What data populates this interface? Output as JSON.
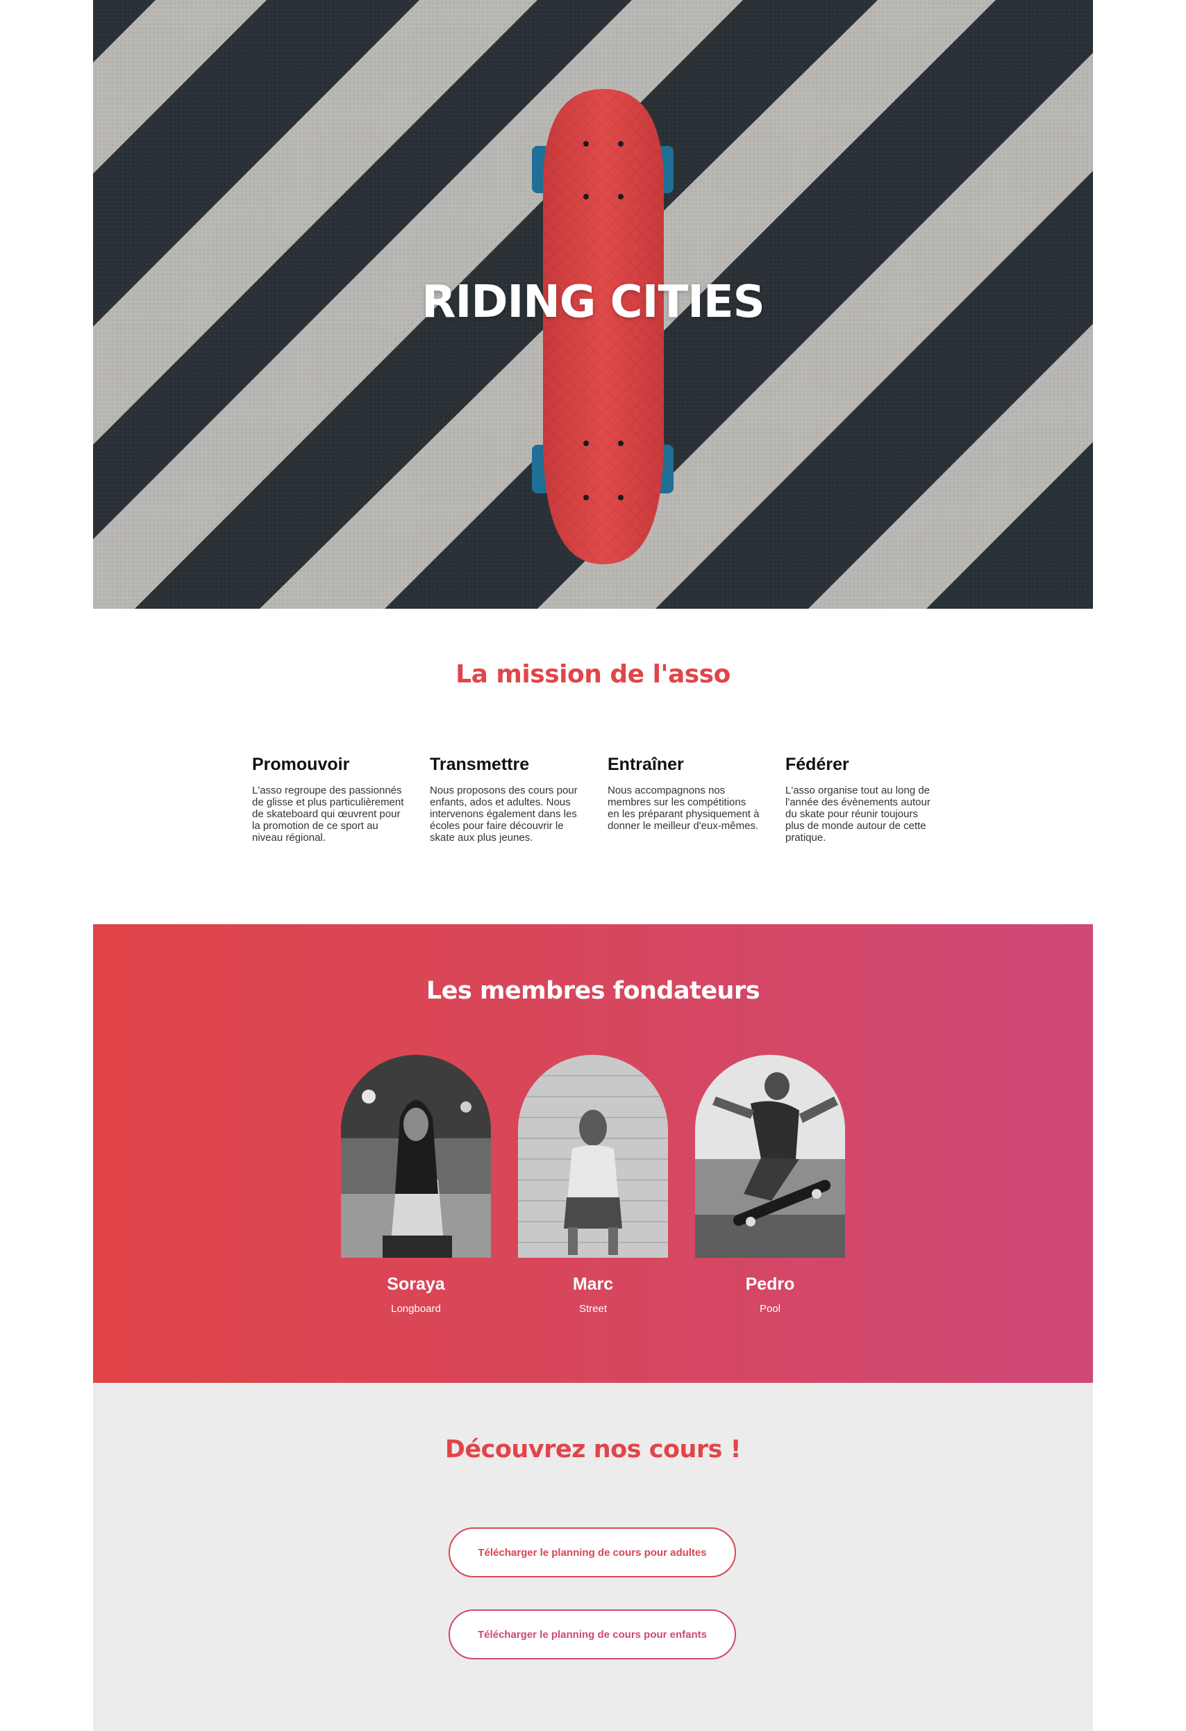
{
  "hero": {
    "title": "RIDING CITIES"
  },
  "mission": {
    "title": "La mission de l'asso",
    "pillars": [
      {
        "title": "Promouvoir",
        "text": "L'asso regroupe des passionnés de glisse et plus particulièrement de skateboard qui œuvrent pour la promotion de ce sport au niveau régional."
      },
      {
        "title": "Transmettre",
        "text": "Nous proposons des cours pour enfants, ados et adultes. Nous intervenons également dans les écoles pour faire découvrir le skate aux plus jeunes."
      },
      {
        "title": "Entraîner",
        "text": "Nous accompagnons nos membres sur les compétitions en les préparant physiquement à donner le meilleur d'eux-mêmes."
      },
      {
        "title": "Fédérer",
        "text": "L'asso organise tout au long de l'année des évènements autour du skate pour réunir toujours plus de monde autour de cette pratique."
      }
    ]
  },
  "founders": {
    "title": "Les membres fondateurs",
    "members": [
      {
        "name": "Soraya",
        "role": "Longboard"
      },
      {
        "name": "Marc",
        "role": "Street"
      },
      {
        "name": "Pedro",
        "role": "Pool"
      }
    ]
  },
  "courses": {
    "title": "Découvrez nos cours !",
    "adults_button": "Télécharger le planning de cours pour adultes",
    "kids_button": "Télécharger le planning de cours pour enfants"
  },
  "colors": {
    "accent_red": "#e0454a",
    "accent_pink": "#cf4878",
    "skateboard": "#d94444",
    "asphalt": "#2a3136",
    "stripe": "#b8b6b2",
    "courses_bg": "#ececec"
  }
}
